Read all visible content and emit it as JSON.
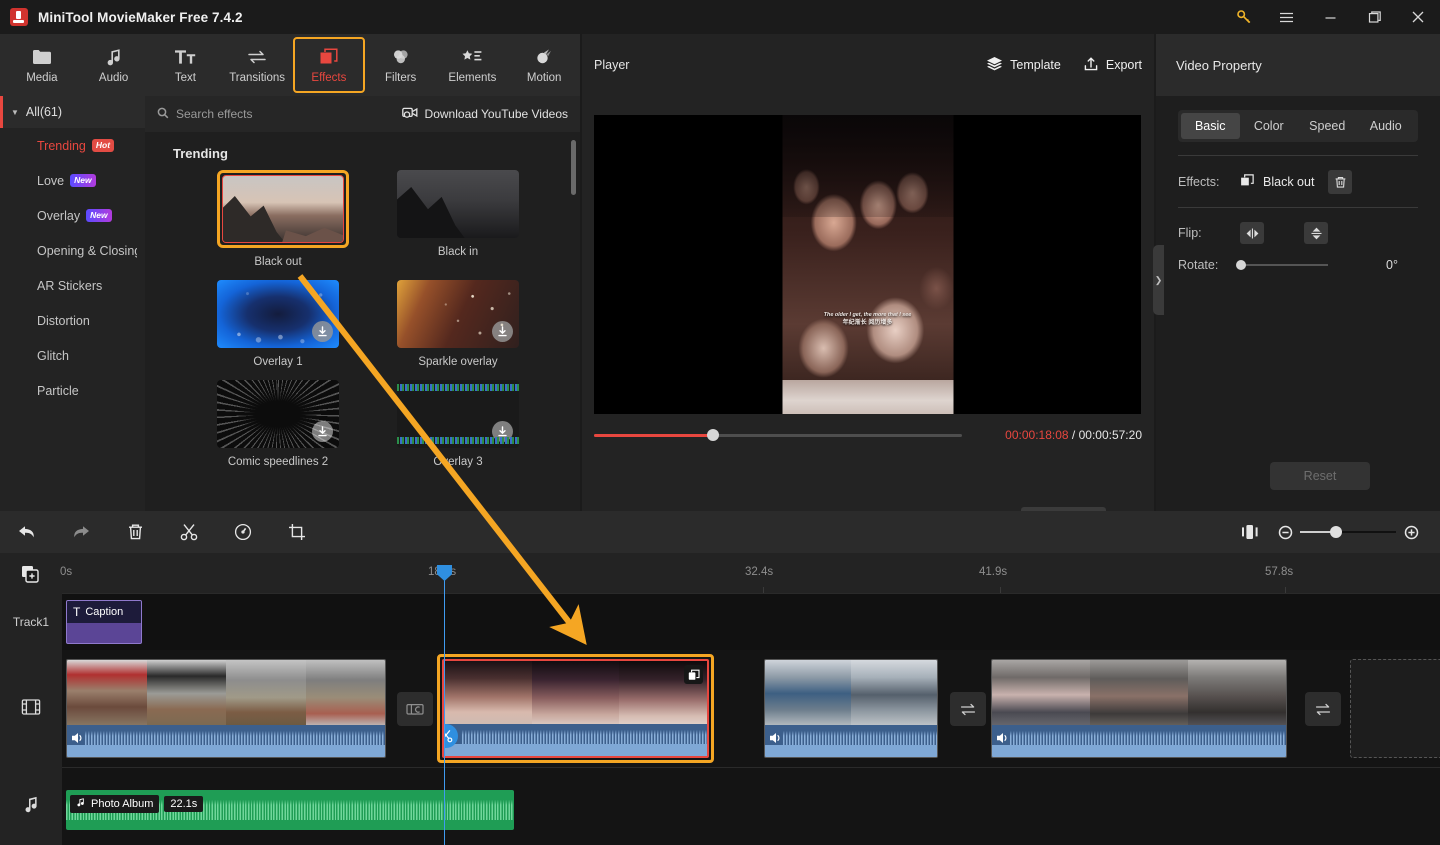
{
  "titlebar": {
    "app_title": "MiniTool MovieMaker Free 7.4.2",
    "buttons": [
      {
        "name": "key-icon",
        "label": ""
      },
      {
        "name": "menu-icon",
        "label": ""
      },
      {
        "name": "minimize-icon",
        "label": ""
      },
      {
        "name": "maximize-icon",
        "label": ""
      },
      {
        "name": "close-icon",
        "label": ""
      }
    ]
  },
  "navbar": {
    "tabs": [
      {
        "label": "Media",
        "icon": "folder-icon",
        "active": false
      },
      {
        "label": "Audio",
        "icon": "music-note-icon",
        "active": false
      },
      {
        "label": "Text",
        "icon": "text-icon",
        "active": false
      },
      {
        "label": "Transitions",
        "icon": "transitions-icon",
        "active": false
      },
      {
        "label": "Effects",
        "icon": "effects-icon",
        "active": true
      },
      {
        "label": "Filters",
        "icon": "filters-icon",
        "active": false
      },
      {
        "label": "Elements",
        "icon": "elements-icon",
        "active": false
      },
      {
        "label": "Motion",
        "icon": "motion-icon",
        "active": false
      }
    ]
  },
  "sidebar": {
    "all_label": "All(61)",
    "items": [
      {
        "label": "Trending",
        "badge": "Hot",
        "badge_type": "hot",
        "highlight": true
      },
      {
        "label": "Love",
        "badge": "New",
        "badge_type": "new",
        "highlight": false
      },
      {
        "label": "Overlay",
        "badge": "New",
        "badge_type": "new",
        "highlight": false
      },
      {
        "label": "Opening & Closing",
        "badge": "",
        "badge_type": "",
        "highlight": false
      },
      {
        "label": "AR Stickers",
        "badge": "",
        "badge_type": "",
        "highlight": false
      },
      {
        "label": "Distortion",
        "badge": "",
        "badge_type": "",
        "highlight": false
      },
      {
        "label": "Glitch",
        "badge": "",
        "badge_type": "",
        "highlight": false
      },
      {
        "label": "Particle",
        "badge": "",
        "badge_type": "",
        "highlight": false
      }
    ]
  },
  "effects": {
    "search_placeholder": "Search effects",
    "download_link": "Download YouTube Videos",
    "section_title": "Trending",
    "items": [
      {
        "label": "Black out",
        "art": "t-blackout",
        "download": false,
        "selected": true
      },
      {
        "label": "Black in",
        "art": "t-blackin",
        "download": false,
        "selected": false
      },
      {
        "label": "Overlay 1",
        "art": "t-overlay1",
        "download": true,
        "selected": false
      },
      {
        "label": "Sparkle overlay",
        "art": "t-sparkle",
        "download": true,
        "selected": false
      },
      {
        "label": "Comic speedlines 2",
        "art": "t-comic",
        "download": true,
        "selected": false
      },
      {
        "label": "Overlay 3",
        "art": "t-overlay3",
        "download": true,
        "selected": false
      }
    ]
  },
  "player": {
    "title": "Player",
    "template_label": "Template",
    "export_label": "Export",
    "current_time": "00:00:18:08",
    "separator": " / ",
    "total_time": "00:00:57:20",
    "aspect_ratio": "16:9",
    "subtitle_en": "The older I get, the more that I see",
    "subtitle_cn": "年纪渐长 阅历增多",
    "controls": [
      "play-button",
      "prev-frame-button",
      "next-frame-button",
      "stop-button",
      "volume-button",
      "volume-slider",
      "aspect-ratio-select",
      "fullscreen-button"
    ]
  },
  "property": {
    "title": "Video Property",
    "tabs": [
      {
        "label": "Basic",
        "active": true
      },
      {
        "label": "Color",
        "active": false
      },
      {
        "label": "Speed",
        "active": false
      },
      {
        "label": "Audio",
        "active": false
      }
    ],
    "effects_label": "Effects:",
    "effects_value": "Black out",
    "flip_label": "Flip:",
    "rotate_label": "Rotate:",
    "rotate_value": "0°",
    "reset_label": "Reset"
  },
  "timeline_toolbar": {
    "buttons": [
      {
        "name": "undo-button",
        "icon": "undo-icon"
      },
      {
        "name": "redo-button",
        "icon": "redo-icon"
      },
      {
        "name": "delete-button",
        "icon": "trash-icon"
      },
      {
        "name": "split-button",
        "icon": "scissors-icon"
      },
      {
        "name": "speed-button",
        "icon": "speed-icon"
      },
      {
        "name": "crop-button",
        "icon": "crop-icon"
      }
    ],
    "zoom_fit_icon": "zoom-fit-icon",
    "zoom_out_icon": "zoom-out-icon",
    "zoom_in_icon": "zoom-in-icon"
  },
  "timeline": {
    "ruler_ticks": [
      "0s",
      "18.3s",
      "32.4s",
      "41.9s",
      "57.8s"
    ],
    "playhead_time": "18.3s",
    "track1_label": "Track1",
    "caption_clip": {
      "label": "Caption",
      "icon": "text-icon"
    },
    "video_clips": [
      {
        "name": "clip-1",
        "selected": false
      },
      {
        "name": "clip-2",
        "selected": true
      },
      {
        "name": "clip-3",
        "selected": false
      },
      {
        "name": "clip-4",
        "selected": false
      }
    ],
    "audio_clip": {
      "name": "Photo Album",
      "duration": "22.1s"
    }
  },
  "colors": {
    "accent_orange": "#f5a623",
    "accent_red": "#e8473f",
    "playhead_blue": "#2f8fe0",
    "audio_green": "#1f9d55",
    "caption_purple": "#5b4596"
  }
}
